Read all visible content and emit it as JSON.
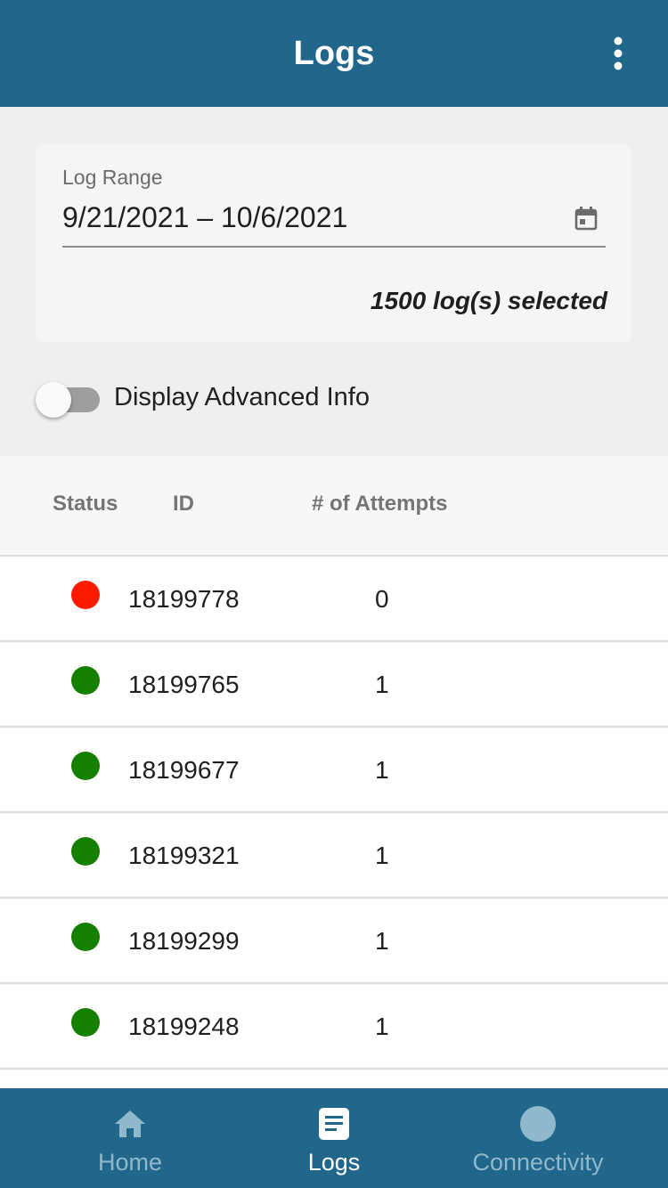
{
  "header": {
    "title": "Logs",
    "menu_icon": "more-vert-icon"
  },
  "filter": {
    "range_label": "Log Range",
    "range_value": "9/21/2021 – 10/6/2021",
    "calendar_icon": "calendar-icon",
    "selected_count": "1500 log(s) selected",
    "advanced_toggle_label": "Display Advanced Info",
    "advanced_toggle_on": false
  },
  "table": {
    "columns": [
      "Status",
      "ID",
      "# of Attempts"
    ],
    "rows": [
      {
        "status": "error",
        "status_color": "#ff1a00",
        "id": "18199778",
        "attempts": "0"
      },
      {
        "status": "success",
        "status_color": "#158000",
        "id": "18199765",
        "attempts": "1"
      },
      {
        "status": "success",
        "status_color": "#158000",
        "id": "18199677",
        "attempts": "1"
      },
      {
        "status": "success",
        "status_color": "#158000",
        "id": "18199321",
        "attempts": "1"
      },
      {
        "status": "success",
        "status_color": "#158000",
        "id": "18199299",
        "attempts": "1"
      },
      {
        "status": "success",
        "status_color": "#158000",
        "id": "18199248",
        "attempts": "1"
      }
    ]
  },
  "bottom_nav": {
    "items": [
      {
        "label": "Home",
        "icon": "home-icon",
        "active": false
      },
      {
        "label": "Logs",
        "icon": "document-icon",
        "active": true
      },
      {
        "label": "Connectivity",
        "icon": "circle-icon",
        "active": false
      }
    ]
  },
  "colors": {
    "primary": "#21668b",
    "nav_inactive": "#8fb8cc",
    "nav_active": "#ffffff"
  }
}
